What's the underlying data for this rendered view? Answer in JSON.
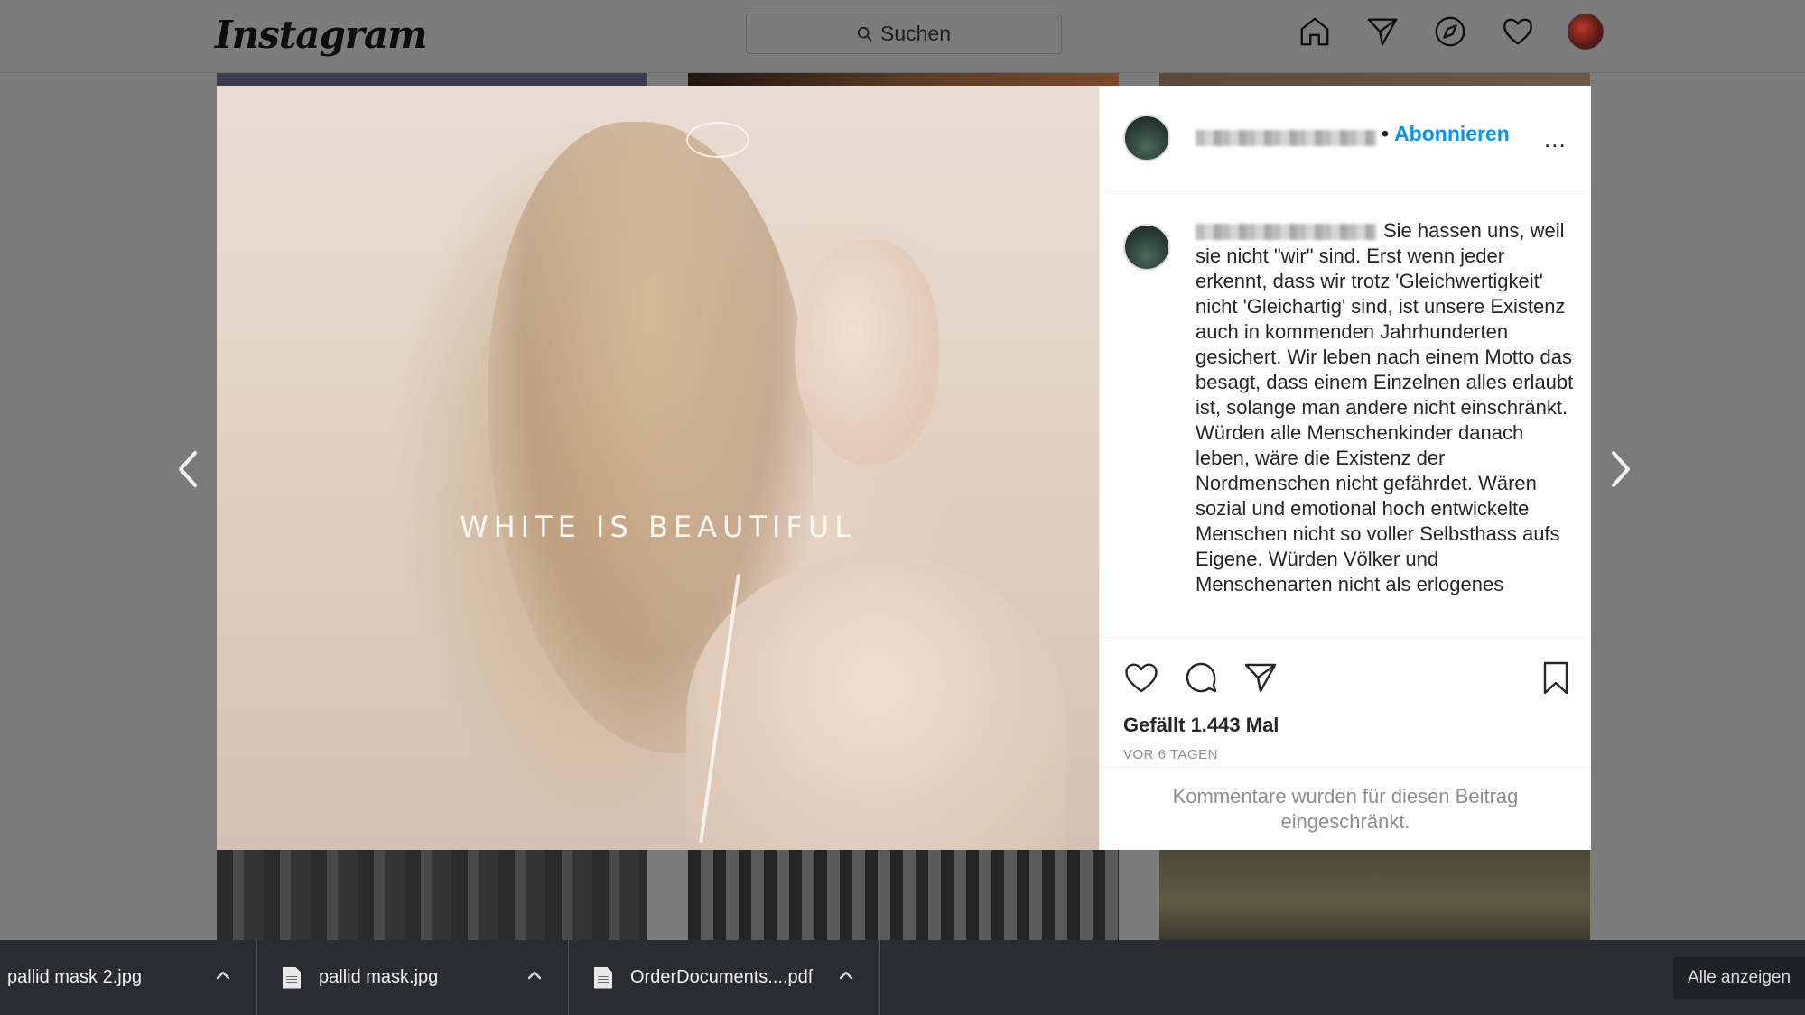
{
  "header": {
    "logo": "Instagram",
    "search_placeholder": "Suchen",
    "nav_icons": [
      "home-icon",
      "direct-icon",
      "explore-icon",
      "activity-heart-icon",
      "profile-avatar"
    ]
  },
  "post": {
    "image_overlay_text": "WHITE IS BEAUTIFUL",
    "follow_label": "Abonnieren",
    "follow_separator": "•",
    "more_label": "...",
    "caption": "Sie hassen uns, weil sie nicht \"wir\" sind. Erst wenn jeder erkennt, dass wir trotz 'Gleichwertigkeit' nicht 'Gleichartig' sind, ist unsere Existenz auch in kommenden Jahrhunderten gesichert. Wir leben nach einem Motto das besagt, dass einem Einzelnen alles erlaubt ist, solange man andere nicht einschränkt. Würden alle Menschenkinder danach leben, wäre die Existenz der Nordmenschen nicht gefährdet. Wären sozial und emotional hoch entwickelte Menschen nicht so voller Selbsthass aufs Eigene. Würden Völker und Menschenarten nicht als erlogenes",
    "likes": "Gefällt 1.443 Mal",
    "timestamp": "VOR 6 TAGEN",
    "comments_restricted": "Kommentare wurden für diesen Beitrag eingeschränkt."
  },
  "downloads": {
    "items": [
      {
        "name": "pallid mask 2.jpg"
      },
      {
        "name": "pallid mask.jpg"
      },
      {
        "name": "OrderDocuments....pdf"
      }
    ],
    "show_all_label": "Alle anzeigen"
  },
  "colors": {
    "accent": "#0095f6",
    "overlay": "#7b7b7b",
    "download_bar": "#2a2c30"
  }
}
